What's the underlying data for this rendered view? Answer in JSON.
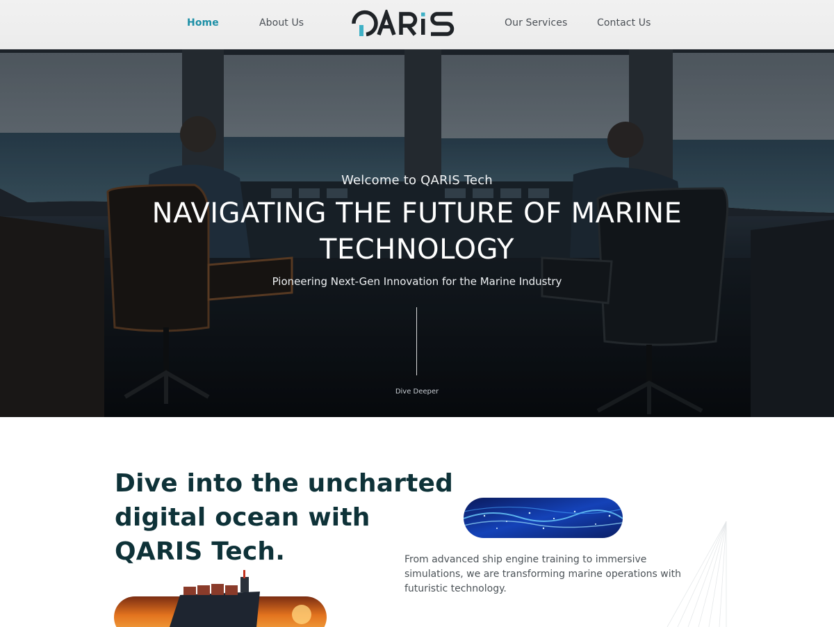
{
  "header": {
    "nav": {
      "home": "Home",
      "about": "About Us",
      "services": "Our Services",
      "contact": "Contact Us"
    },
    "logo_text": "QARIS",
    "accent_color": "#1c8fa6"
  },
  "hero": {
    "eyebrow": "Welcome to QARIS Tech",
    "title": "NAVIGATING THE FUTURE OF MARINE TECHNOLOGY",
    "subtitle": "Pioneering Next-Gen Innovation for the Marine Industry",
    "scroll_label": "Dive Deeper"
  },
  "intro": {
    "title": "Dive into the uncharted digital ocean with QARIS Tech.",
    "text": "From advanced ship engine training to immersive simulations, we are transforming marine operations with futuristic technology.",
    "title_color": "#0e3238"
  }
}
